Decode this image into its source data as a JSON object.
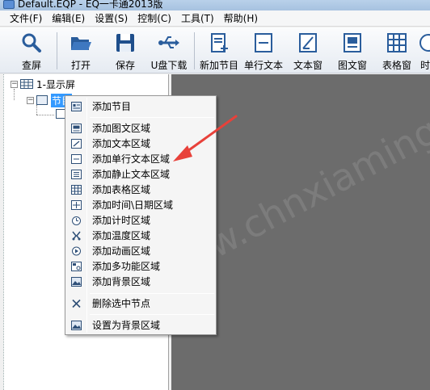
{
  "window": {
    "title": "Default.EQP - EQ一卡通2013版"
  },
  "menubar": {
    "items": [
      "文件(F)",
      "编辑(E)",
      "设置(S)",
      "控制(C)",
      "工具(T)",
      "帮助(H)"
    ]
  },
  "toolbar": {
    "buttons": [
      {
        "label": "查屏",
        "icon": "search-icon"
      },
      {
        "label": "打开",
        "icon": "folder-icon"
      },
      {
        "label": "保存",
        "icon": "save-icon"
      },
      {
        "label": "U盘下载",
        "icon": "usb-icon"
      },
      {
        "label": "新加节目",
        "icon": "new-program-icon"
      },
      {
        "label": "单行文本",
        "icon": "single-line-text-icon"
      },
      {
        "label": "文本窗",
        "icon": "text-window-icon"
      },
      {
        "label": "图文窗",
        "icon": "image-text-window-icon"
      },
      {
        "label": "表格窗",
        "icon": "table-window-icon"
      },
      {
        "label": "时",
        "icon": "clock-icon"
      }
    ]
  },
  "tree": {
    "root_label": "1-显示屏",
    "program_label": "节目"
  },
  "watermark": "www.chnxiaming.com.cn",
  "context_menu": {
    "items": [
      {
        "label": "添加节目",
        "icon": "program-icon"
      },
      {
        "label": "添加图文区域",
        "icon": "image-text-area-icon"
      },
      {
        "label": "添加文本区域",
        "icon": "text-area-icon"
      },
      {
        "label": "添加单行文本区域",
        "icon": "single-line-text-area-icon"
      },
      {
        "label": "添加静止文本区域",
        "icon": "static-text-area-icon"
      },
      {
        "label": "添加表格区域",
        "icon": "table-area-icon"
      },
      {
        "label": "添加时间\\日期区域",
        "icon": "datetime-area-icon"
      },
      {
        "label": "添加计时区域",
        "icon": "timer-area-icon"
      },
      {
        "label": "添加温度区域",
        "icon": "temperature-area-icon"
      },
      {
        "label": "添加动画区域",
        "icon": "animation-area-icon"
      },
      {
        "label": "添加多功能区域",
        "icon": "multifunction-area-icon"
      },
      {
        "label": "添加背景区域",
        "icon": "background-area-icon"
      },
      {
        "label": "删除选中节点",
        "icon": "delete-icon"
      },
      {
        "label": "设置为背景区域",
        "icon": "set-background-icon"
      }
    ]
  },
  "colors": {
    "selection": "#3399ff",
    "canvas": "#6c6c6c",
    "arrow": "#e8413a",
    "icon_blue": "#2e4f77"
  }
}
